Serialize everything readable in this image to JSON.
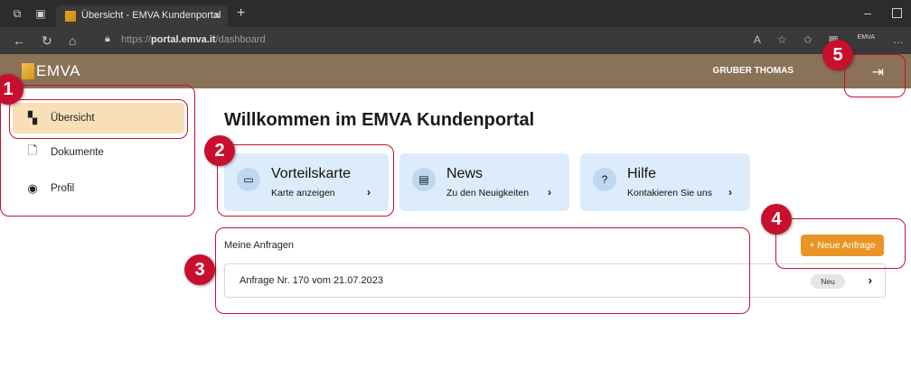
{
  "browser": {
    "tab_title": "Übersicht - EMVA Kundenportal",
    "tab_close": "×",
    "new_tab": "+",
    "url_prefix": "https://",
    "url_host": "portal.emva.it",
    "url_path": "/dashboard",
    "profile_label": "EMVA"
  },
  "header": {
    "logo_text": "EMVA",
    "user_name": "GRUBER THOMAS",
    "logout_icon": "logout-icon"
  },
  "sidebar": {
    "items": [
      {
        "label": "Übersicht",
        "icon": "dashboard-icon",
        "active": true
      },
      {
        "label": "Dokumente",
        "icon": "document-icon",
        "active": false
      },
      {
        "label": "Profil",
        "icon": "profile-icon",
        "active": false
      }
    ]
  },
  "main": {
    "welcome": "Willkommen im EMVA Kundenportal",
    "cards": [
      {
        "title": "Vorteilskarte",
        "subtitle": "Karte anzeigen",
        "icon": "card-icon"
      },
      {
        "title": "News",
        "subtitle": "Zu den Neuigkeiten",
        "icon": "news-icon"
      },
      {
        "title": "Hilfe",
        "subtitle": "Kontakieren Sie uns",
        "icon": "help-icon"
      }
    ],
    "requests": {
      "title": "Meine Anfragen",
      "new_button": "+ Neue Anfrage",
      "rows": [
        {
          "text": "Anfrage Nr. 170 vom 21.07.2023",
          "status": "Neu"
        }
      ]
    }
  },
  "annotations": [
    "1",
    "2",
    "3",
    "4",
    "5"
  ],
  "colors": {
    "header_bg": "#8a7258",
    "accent_orange": "#e99525",
    "active_item_bg": "#f8dfb8",
    "card_bg": "#dcecfa",
    "annotation_red": "#c8102e"
  }
}
